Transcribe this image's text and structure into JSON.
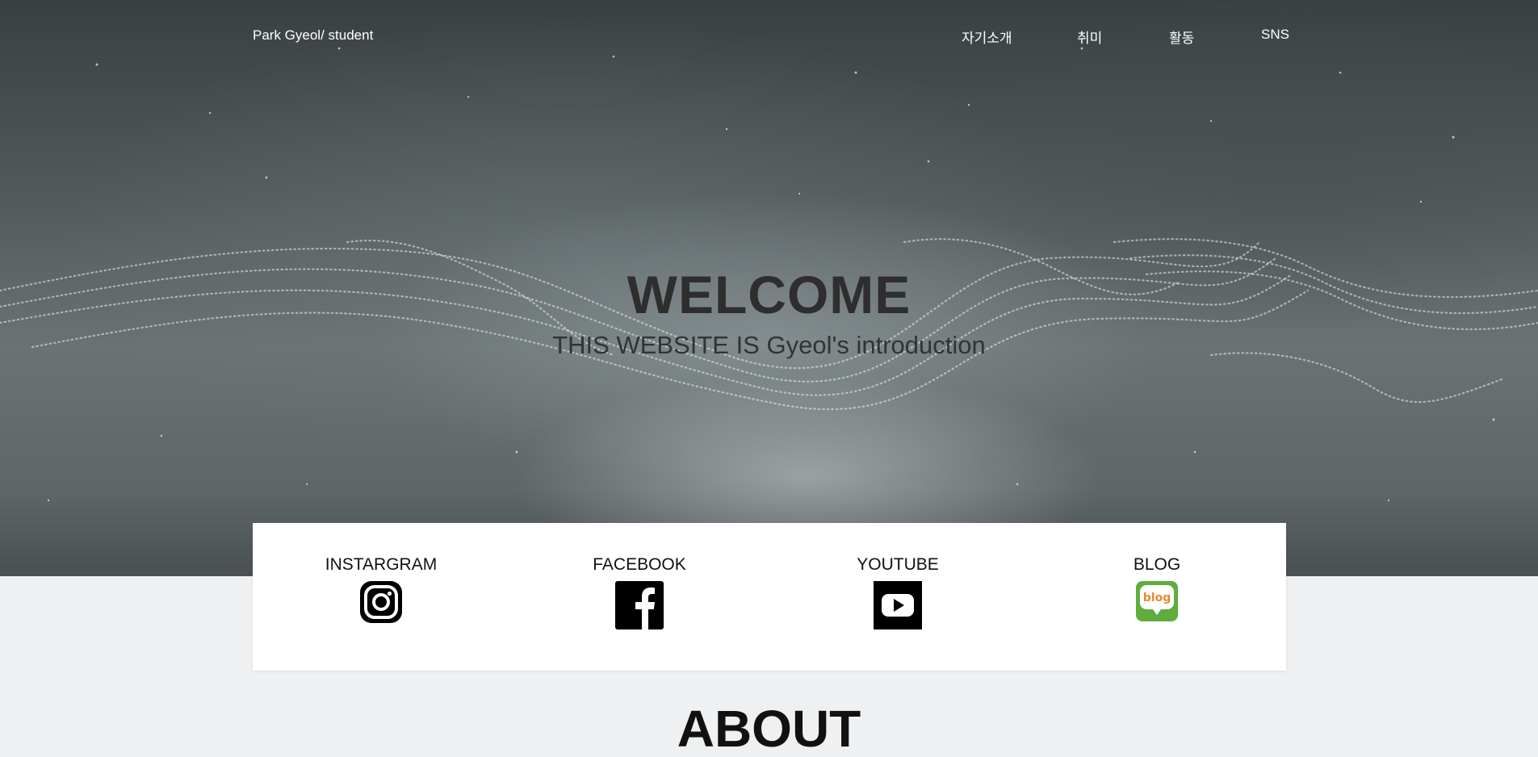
{
  "nav": {
    "brand": "Park Gyeol/ student",
    "items": [
      {
        "label": "자기소개"
      },
      {
        "label": "취미"
      },
      {
        "label": "활동"
      },
      {
        "label": "SNS"
      }
    ]
  },
  "hero": {
    "title": "WELCOME",
    "subtitle": "THIS WEBSITE IS Gyeol's introduction"
  },
  "sns": {
    "items": [
      {
        "label": "INSTARGRAM",
        "icon": "instagram-icon"
      },
      {
        "label": "FACEBOOK",
        "icon": "facebook-icon"
      },
      {
        "label": "YOUTUBE",
        "icon": "youtube-icon"
      },
      {
        "label": "BLOG",
        "icon": "blog-icon",
        "icon_text": "blog"
      }
    ]
  },
  "about": {
    "title": "ABOUT"
  },
  "colors": {
    "blog_green": "#5fad3c",
    "blog_orange": "#e8892c"
  }
}
